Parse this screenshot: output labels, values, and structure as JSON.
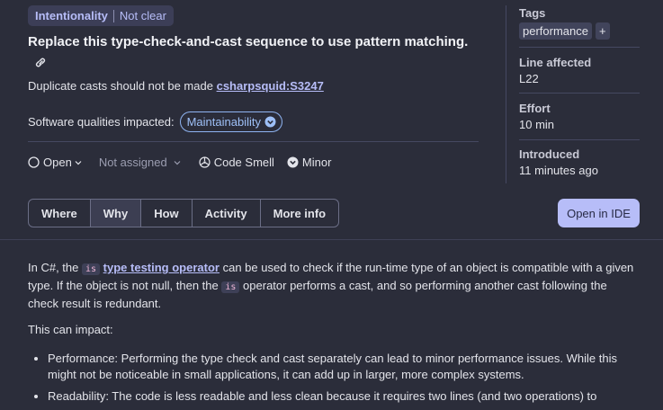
{
  "badge": {
    "primary": "Intentionality",
    "secondary": "Not clear"
  },
  "title": "Replace this type-check-and-cast sequence to use pattern matching.",
  "description": {
    "prefix": "Duplicate casts should not be made",
    "rule": "csharpsquid:S3247"
  },
  "qualities": {
    "label": "Software qualities impacted:",
    "value": "Maintainability"
  },
  "meta": {
    "status": "Open",
    "assignee": "Not assigned",
    "type": "Code Smell",
    "severity": "Minor"
  },
  "side": {
    "tags_label": "Tags",
    "tag": "performance",
    "tag_add": "+",
    "line_label": "Line affected",
    "line_value": "L22",
    "effort_label": "Effort",
    "effort_value": "10 min",
    "introduced_label": "Introduced",
    "introduced_value": "11 minutes ago"
  },
  "tabs": [
    "Where",
    "Why",
    "How",
    "Activity",
    "More info"
  ],
  "active_tab": "Why",
  "open_ide": "Open in IDE",
  "content": {
    "p1_a": "In C#, the",
    "p1_code1": "is",
    "p1_link": "type testing operator",
    "p1_b": "can be used to check if the run-time type of an object is compatible with a given type. If the object is not null, then the",
    "p1_code2": "is",
    "p1_c": "operator performs a cast, and so performing another cast following the check result is redundant.",
    "p2": "This can impact:",
    "bullets": [
      "Performance: Performing the type check and cast separately can lead to minor performance issues. While this might not be noticeable in small applications, it can add up in larger, more complex systems.",
      "Readability: The code is less readable and less clean because it requires two lines (and two operations) to"
    ]
  },
  "colors": {
    "background": "#2b2d3a",
    "accent": "#b7bdf8",
    "pill": "#9ec0f7"
  }
}
